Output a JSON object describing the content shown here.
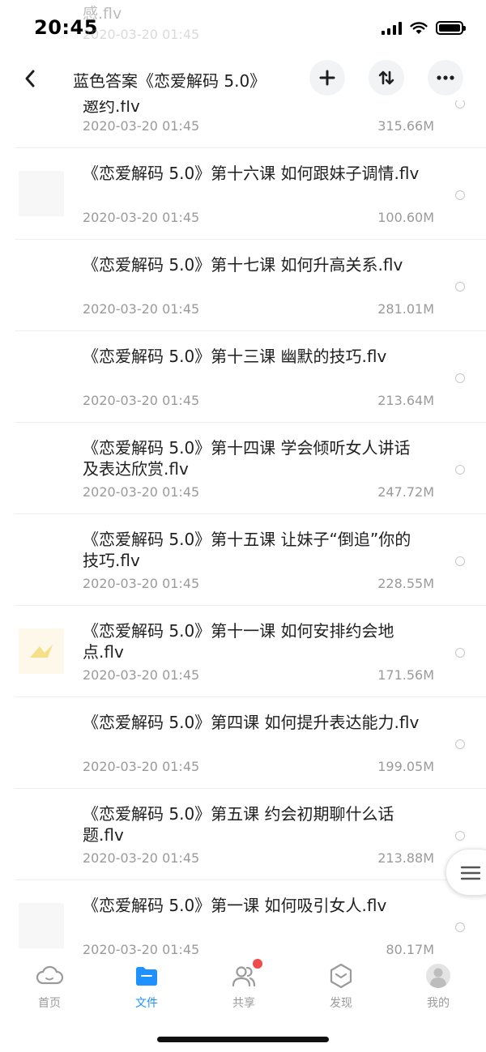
{
  "status_bar": {
    "time": "20:45"
  },
  "ghost_row": {
    "name": "感.flv",
    "date": "2020-03-20 01:45"
  },
  "header": {
    "title": "蓝色答案《恋爱解码 5.0》"
  },
  "files": [
    {
      "name": "邀约.flv",
      "date": "2020-03-20 01:45",
      "size": "315.66M"
    },
    {
      "name": "《恋爱解码 5.0》第十六课 如何跟妹子调情.flv",
      "date": "2020-03-20 01:45",
      "size": "100.60M"
    },
    {
      "name": "《恋爱解码 5.0》第十七课 如何升高关系.flv",
      "date": "2020-03-20 01:45",
      "size": "281.01M"
    },
    {
      "name": "《恋爱解码 5.0》第十三课 幽默的技巧.flv",
      "date": "2020-03-20 01:45",
      "size": "213.64M"
    },
    {
      "name": "《恋爱解码 5.0》第十四课 学会倾听女人讲话及表达欣赏.flv",
      "date": "2020-03-20 01:45",
      "size": "247.72M"
    },
    {
      "name": "《恋爱解码 5.0》第十五课 让妹子“倒追”你的技巧.flv",
      "date": "2020-03-20 01:45",
      "size": "228.55M"
    },
    {
      "name": "《恋爱解码 5.0》第十一课 如何安排约会地点.flv",
      "date": "2020-03-20 01:45",
      "size": "171.56M"
    },
    {
      "name": "《恋爱解码 5.0》第四课 如何提升表达能力.flv",
      "date": "2020-03-20 01:45",
      "size": "199.05M"
    },
    {
      "name": "《恋爱解码 5.0》第五课 约会初期聊什么话题.flv",
      "date": "2020-03-20 01:45",
      "size": "213.88M"
    },
    {
      "name": "《恋爱解码 5.0》第一课 如何吸引女人.flv",
      "date": "2020-03-20 01:45",
      "size": "80.17M"
    }
  ],
  "tabs": [
    {
      "label": "首页"
    },
    {
      "label": "文件"
    },
    {
      "label": "共享"
    },
    {
      "label": "发现"
    },
    {
      "label": "我的"
    }
  ],
  "colors": {
    "accent": "#1e90ff",
    "badge": "#f04a4a"
  }
}
